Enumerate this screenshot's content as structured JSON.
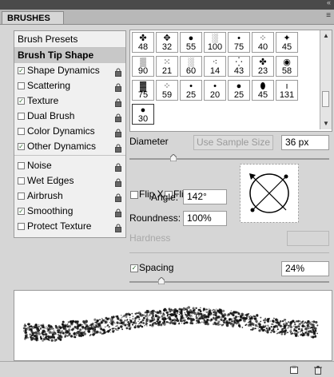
{
  "panel": {
    "tab_title": "BRUSHES",
    "collapse_glyph": "«",
    "menu_glyph": "≡"
  },
  "left_list": {
    "items": [
      {
        "label": "Brush Presets",
        "checkbox": false,
        "checked": false,
        "lock": false,
        "selected": false
      },
      {
        "label": "Brush Tip Shape",
        "checkbox": false,
        "checked": false,
        "lock": false,
        "selected": true
      },
      {
        "label": "Shape Dynamics",
        "checkbox": true,
        "checked": true,
        "lock": true,
        "selected": false
      },
      {
        "label": "Scattering",
        "checkbox": true,
        "checked": false,
        "lock": true,
        "selected": false
      },
      {
        "label": "Texture",
        "checkbox": true,
        "checked": true,
        "lock": true,
        "selected": false
      },
      {
        "label": "Dual Brush",
        "checkbox": true,
        "checked": false,
        "lock": true,
        "selected": false
      },
      {
        "label": "Color Dynamics",
        "checkbox": true,
        "checked": false,
        "lock": true,
        "selected": false
      },
      {
        "label": "Other Dynamics",
        "checkbox": true,
        "checked": true,
        "lock": true,
        "selected": false
      },
      {
        "label": "Noise",
        "checkbox": true,
        "checked": false,
        "lock": true,
        "selected": false
      },
      {
        "label": "Wet Edges",
        "checkbox": true,
        "checked": false,
        "lock": true,
        "selected": false
      },
      {
        "label": "Airbrush",
        "checkbox": true,
        "checked": false,
        "lock": true,
        "selected": false
      },
      {
        "label": "Smoothing",
        "checkbox": true,
        "checked": true,
        "lock": true,
        "selected": false
      },
      {
        "label": "Protect Texture",
        "checkbox": true,
        "checked": false,
        "lock": true,
        "selected": false
      }
    ]
  },
  "brush_grid": {
    "cells": [
      {
        "size": "48",
        "icon": "splatter-brush-icon",
        "glyph": "✤",
        "selected": false
      },
      {
        "size": "32",
        "icon": "splatter-brush-icon",
        "glyph": "✥",
        "selected": false
      },
      {
        "size": "55",
        "icon": "hard-round-brush-icon",
        "glyph": "●",
        "selected": false
      },
      {
        "size": "100",
        "icon": "soft-texture-brush-icon",
        "glyph": "░",
        "selected": false
      },
      {
        "size": "75",
        "icon": "soft-round-brush-icon",
        "glyph": "•",
        "selected": false
      },
      {
        "size": "40",
        "icon": "speckle-brush-icon",
        "glyph": "⁘",
        "selected": false
      },
      {
        "size": "45",
        "icon": "splatter-brush-icon",
        "glyph": "✦",
        "selected": false
      },
      {
        "size": "90",
        "icon": "chalk-brush-icon",
        "glyph": "▒",
        "selected": false
      },
      {
        "size": "21",
        "icon": "scatter-brush-icon",
        "glyph": "⁙",
        "selected": false
      },
      {
        "size": "60",
        "icon": "dry-brush-icon",
        "glyph": "░",
        "selected": false
      },
      {
        "size": "14",
        "icon": "grass-brush-icon",
        "glyph": "⁖",
        "selected": false
      },
      {
        "size": "43",
        "icon": "scatter-brush-icon",
        "glyph": "⁛",
        "selected": false
      },
      {
        "size": "23",
        "icon": "splatter-brush-icon",
        "glyph": "✤",
        "selected": false
      },
      {
        "size": "58",
        "icon": "soft-round-brush-icon",
        "glyph": "◉",
        "selected": false
      },
      {
        "size": "75",
        "icon": "texture-brush-icon",
        "glyph": "▓",
        "selected": false
      },
      {
        "size": "59",
        "icon": "scatter-brush-icon",
        "glyph": "⁘",
        "selected": false
      },
      {
        "size": "25",
        "icon": "soft-round-brush-icon",
        "glyph": "•",
        "selected": false
      },
      {
        "size": "20",
        "icon": "soft-round-brush-icon",
        "glyph": "•",
        "selected": false
      },
      {
        "size": "25",
        "icon": "hard-round-brush-icon",
        "glyph": "●",
        "selected": false
      },
      {
        "size": "45",
        "icon": "calligraphy-brush-icon",
        "glyph": "⬮",
        "selected": false
      },
      {
        "size": "131",
        "icon": "thin-brush-icon",
        "glyph": "ı",
        "selected": false
      },
      {
        "size": "30",
        "icon": "hard-round-brush-icon",
        "glyph": "●",
        "selected": true
      }
    ]
  },
  "settings": {
    "diameter_label": "Diameter",
    "use_sample_size_label": "Use Sample Size",
    "diameter_value": "36 px",
    "flip_x_label": "Flip X",
    "flip_y_label": "Flip Y",
    "angle_label": "Angle:",
    "angle_value": "142°",
    "roundness_label": "Roundness:",
    "roundness_value": "100%",
    "hardness_label": "Hardness",
    "hardness_value": "",
    "spacing_label": "Spacing",
    "spacing_checked": true,
    "spacing_value": "24%",
    "diameter_slider_fraction": 0.22,
    "spacing_slider_fraction": 0.16
  },
  "bottom_bar": {
    "new_preset_icon": "new-preset-icon",
    "trash_icon": "trash-icon"
  }
}
